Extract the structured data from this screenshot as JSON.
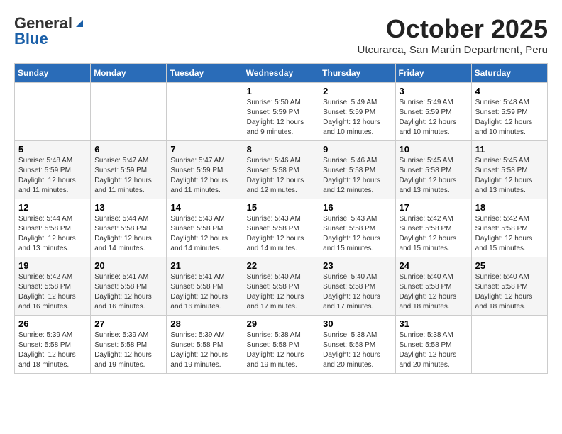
{
  "logo": {
    "general": "General",
    "blue": "Blue"
  },
  "header": {
    "month_year": "October 2025",
    "location": "Utcurarca, San Martin Department, Peru"
  },
  "days_of_week": [
    "Sunday",
    "Monday",
    "Tuesday",
    "Wednesday",
    "Thursday",
    "Friday",
    "Saturday"
  ],
  "weeks": [
    [
      {
        "day": "",
        "info": ""
      },
      {
        "day": "",
        "info": ""
      },
      {
        "day": "",
        "info": ""
      },
      {
        "day": "1",
        "info": "Sunrise: 5:50 AM\nSunset: 5:59 PM\nDaylight: 12 hours and 9 minutes."
      },
      {
        "day": "2",
        "info": "Sunrise: 5:49 AM\nSunset: 5:59 PM\nDaylight: 12 hours and 10 minutes."
      },
      {
        "day": "3",
        "info": "Sunrise: 5:49 AM\nSunset: 5:59 PM\nDaylight: 12 hours and 10 minutes."
      },
      {
        "day": "4",
        "info": "Sunrise: 5:48 AM\nSunset: 5:59 PM\nDaylight: 12 hours and 10 minutes."
      }
    ],
    [
      {
        "day": "5",
        "info": "Sunrise: 5:48 AM\nSunset: 5:59 PM\nDaylight: 12 hours and 11 minutes."
      },
      {
        "day": "6",
        "info": "Sunrise: 5:47 AM\nSunset: 5:59 PM\nDaylight: 12 hours and 11 minutes."
      },
      {
        "day": "7",
        "info": "Sunrise: 5:47 AM\nSunset: 5:59 PM\nDaylight: 12 hours and 11 minutes."
      },
      {
        "day": "8",
        "info": "Sunrise: 5:46 AM\nSunset: 5:58 PM\nDaylight: 12 hours and 12 minutes."
      },
      {
        "day": "9",
        "info": "Sunrise: 5:46 AM\nSunset: 5:58 PM\nDaylight: 12 hours and 12 minutes."
      },
      {
        "day": "10",
        "info": "Sunrise: 5:45 AM\nSunset: 5:58 PM\nDaylight: 12 hours and 13 minutes."
      },
      {
        "day": "11",
        "info": "Sunrise: 5:45 AM\nSunset: 5:58 PM\nDaylight: 12 hours and 13 minutes."
      }
    ],
    [
      {
        "day": "12",
        "info": "Sunrise: 5:44 AM\nSunset: 5:58 PM\nDaylight: 12 hours and 13 minutes."
      },
      {
        "day": "13",
        "info": "Sunrise: 5:44 AM\nSunset: 5:58 PM\nDaylight: 12 hours and 14 minutes."
      },
      {
        "day": "14",
        "info": "Sunrise: 5:43 AM\nSunset: 5:58 PM\nDaylight: 12 hours and 14 minutes."
      },
      {
        "day": "15",
        "info": "Sunrise: 5:43 AM\nSunset: 5:58 PM\nDaylight: 12 hours and 14 minutes."
      },
      {
        "day": "16",
        "info": "Sunrise: 5:43 AM\nSunset: 5:58 PM\nDaylight: 12 hours and 15 minutes."
      },
      {
        "day": "17",
        "info": "Sunrise: 5:42 AM\nSunset: 5:58 PM\nDaylight: 12 hours and 15 minutes."
      },
      {
        "day": "18",
        "info": "Sunrise: 5:42 AM\nSunset: 5:58 PM\nDaylight: 12 hours and 15 minutes."
      }
    ],
    [
      {
        "day": "19",
        "info": "Sunrise: 5:42 AM\nSunset: 5:58 PM\nDaylight: 12 hours and 16 minutes."
      },
      {
        "day": "20",
        "info": "Sunrise: 5:41 AM\nSunset: 5:58 PM\nDaylight: 12 hours and 16 minutes."
      },
      {
        "day": "21",
        "info": "Sunrise: 5:41 AM\nSunset: 5:58 PM\nDaylight: 12 hours and 16 minutes."
      },
      {
        "day": "22",
        "info": "Sunrise: 5:40 AM\nSunset: 5:58 PM\nDaylight: 12 hours and 17 minutes."
      },
      {
        "day": "23",
        "info": "Sunrise: 5:40 AM\nSunset: 5:58 PM\nDaylight: 12 hours and 17 minutes."
      },
      {
        "day": "24",
        "info": "Sunrise: 5:40 AM\nSunset: 5:58 PM\nDaylight: 12 hours and 18 minutes."
      },
      {
        "day": "25",
        "info": "Sunrise: 5:40 AM\nSunset: 5:58 PM\nDaylight: 12 hours and 18 minutes."
      }
    ],
    [
      {
        "day": "26",
        "info": "Sunrise: 5:39 AM\nSunset: 5:58 PM\nDaylight: 12 hours and 18 minutes."
      },
      {
        "day": "27",
        "info": "Sunrise: 5:39 AM\nSunset: 5:58 PM\nDaylight: 12 hours and 19 minutes."
      },
      {
        "day": "28",
        "info": "Sunrise: 5:39 AM\nSunset: 5:58 PM\nDaylight: 12 hours and 19 minutes."
      },
      {
        "day": "29",
        "info": "Sunrise: 5:38 AM\nSunset: 5:58 PM\nDaylight: 12 hours and 19 minutes."
      },
      {
        "day": "30",
        "info": "Sunrise: 5:38 AM\nSunset: 5:58 PM\nDaylight: 12 hours and 20 minutes."
      },
      {
        "day": "31",
        "info": "Sunrise: 5:38 AM\nSunset: 5:58 PM\nDaylight: 12 hours and 20 minutes."
      },
      {
        "day": "",
        "info": ""
      }
    ]
  ]
}
